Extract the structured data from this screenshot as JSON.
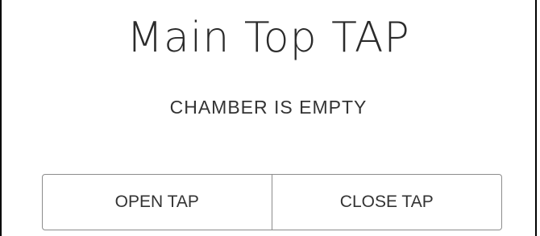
{
  "panel": {
    "title": "Main Top TAP",
    "status": "CHAMBER IS EMPTY",
    "buttons": {
      "open_label": "OPEN TAP",
      "close_label": "CLOSE TAP"
    }
  },
  "colors": {
    "border": "#000000",
    "text": "#333333",
    "button_border": "#8c8c8c"
  }
}
